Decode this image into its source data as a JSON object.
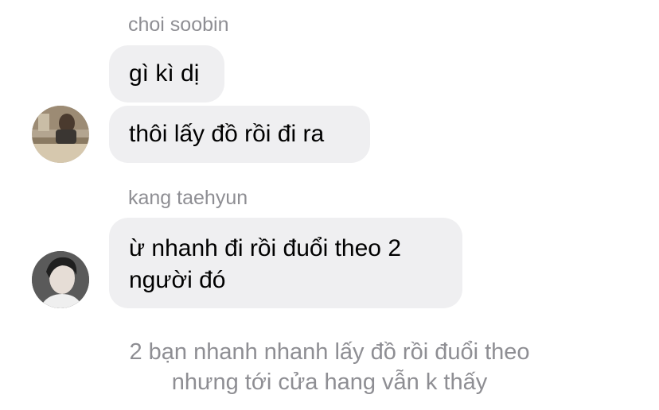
{
  "chat": {
    "group1": {
      "sender": "choi soobin",
      "messages": [
        "gì kì dị",
        "thôi lấy đồ rồi đi ra"
      ]
    },
    "group2": {
      "sender": "kang taehyun",
      "messages": [
        {
          "line1": "ừ nhanh đi rồi đuổi theo 2",
          "line2": "người đó"
        }
      ]
    },
    "narration": {
      "line1": "2 bạn nhanh nhanh lấy đồ rồi đuổi theo",
      "line2": "nhưng tới cửa hang vẫn k thấy"
    }
  },
  "colors": {
    "bubble": "#efeff1",
    "sender_text": "#8e8e93",
    "narration_text": "#8e8e93"
  }
}
